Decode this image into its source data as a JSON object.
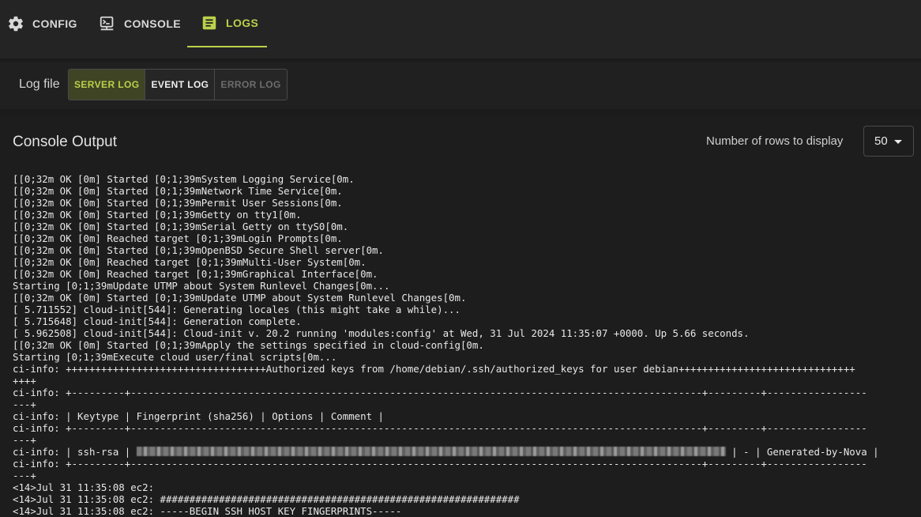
{
  "tabs": [
    {
      "label": "CONFIG",
      "icon": "gear-icon"
    },
    {
      "label": "CONSOLE",
      "icon": "console-icon"
    },
    {
      "label": "LOGS",
      "icon": "logs-icon"
    }
  ],
  "active_tab": "LOGS",
  "log_file": {
    "label": "Log file",
    "buttons": [
      {
        "label": "SERVER LOG",
        "state": "selected"
      },
      {
        "label": "EVENT LOG",
        "state": "normal"
      },
      {
        "label": "ERROR LOG",
        "state": "disabled"
      }
    ]
  },
  "panel": {
    "title": "Console Output",
    "rows_label": "Number of rows to display",
    "rows_value": "50"
  },
  "colors": {
    "accent": "#bcd04a",
    "background": "#1b1b1b"
  },
  "console_lines": [
    "[[0;32m OK [0m] Started [0;1;39mSystem Logging Service[0m.",
    "[[0;32m OK [0m] Started [0;1;39mNetwork Time Service[0m.",
    "[[0;32m OK [0m] Started [0;1;39mPermit User Sessions[0m.",
    "[[0;32m OK [0m] Started [0;1;39mGetty on tty1[0m.",
    "[[0;32m OK [0m] Started [0;1;39mSerial Getty on ttyS0[0m.",
    "[[0;32m OK [0m] Reached target [0;1;39mLogin Prompts[0m.",
    "[[0;32m OK [0m] Started [0;1;39mOpenBSD Secure Shell server[0m.",
    "[[0;32m OK [0m] Reached target [0;1;39mMulti-User System[0m.",
    "[[0;32m OK [0m] Reached target [0;1;39mGraphical Interface[0m.",
    "Starting [0;1;39mUpdate UTMP about System Runlevel Changes[0m...",
    "[[0;32m OK [0m] Started [0;1;39mUpdate UTMP about System Runlevel Changes[0m.",
    "[ 5.711552] cloud-init[544]: Generating locales (this might take a while)...",
    "[ 5.715648] cloud-init[544]: Generation complete.",
    "[ 5.962508] cloud-init[544]: Cloud-init v. 20.2 running 'modules:config' at Wed, 31 Jul 2024 11:35:07 +0000. Up 5.66 seconds.",
    "[[0;32m OK [0m] Started [0;1;39mApply the settings specified in cloud-config[0m.",
    "Starting [0;1;39mExecute cloud user/final scripts[0m...",
    "ci-info: ++++++++++++++++++++++++++++++++++Authorized keys from /home/debian/.ssh/authorized_keys for user debian++++++++++++++++++++++++++++++",
    "++++",
    "ci-info: +---------+-------------------------------------------------------------------------------------------------+---------+-----------------",
    "---+",
    "ci-info: | Keytype | Fingerprint (sha256) | Options | Comment |",
    "ci-info: +---------+-------------------------------------------------------------------------------------------------+---------+-----------------",
    "---+",
    "ci-info: | ssh-rsa | ",
    "ci-info: +---------+-------------------------------------------------------------------------------------------------+---------+-----------------",
    "---+",
    "<14>Jul 31 11:35:08 ec2:",
    "<14>Jul 31 11:35:08 ec2: #############################################################",
    "<14>Jul 31 11:35:08 ec2: -----BEGIN SSH HOST KEY FINGERPRINTS-----"
  ],
  "ssh_row_suffix": " | - | Generated-by-Nova |"
}
